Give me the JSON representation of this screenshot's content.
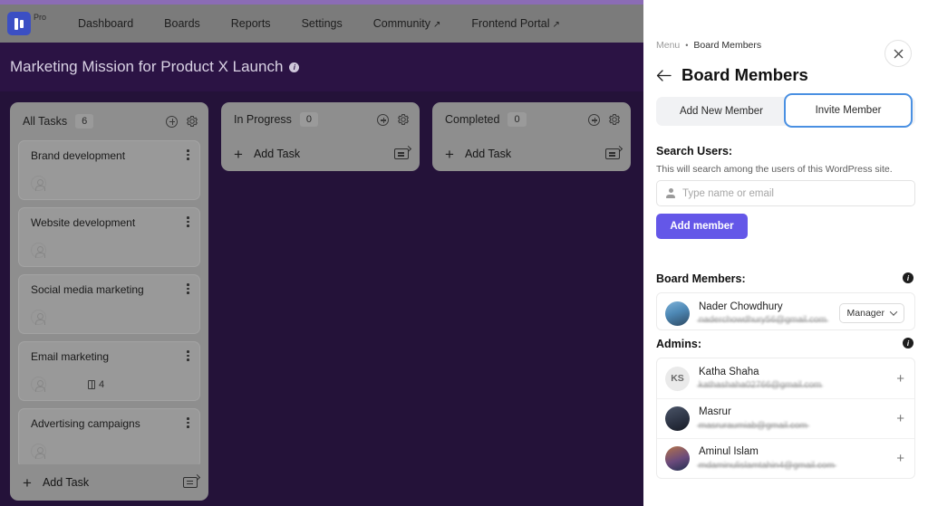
{
  "navbar": {
    "logo_name": "wedevs-pro-logo",
    "pro_badge": "Pro",
    "items": [
      {
        "label": "Dashboard",
        "external": ""
      },
      {
        "label": "Boards",
        "external": ""
      },
      {
        "label": "Reports",
        "external": ""
      },
      {
        "label": "Settings",
        "external": ""
      },
      {
        "label": "Community",
        "external": "↗"
      },
      {
        "label": "Frontend Portal",
        "external": "↗"
      }
    ]
  },
  "board": {
    "title": "Marketing Mission for Product X Launch",
    "info_glyph": "i",
    "add_task_label": "Add Task",
    "columns": [
      {
        "name": "All Tasks",
        "count": "6",
        "tasks": [
          {
            "title": "Brand development",
            "attachments": ""
          },
          {
            "title": "Website development",
            "attachments": ""
          },
          {
            "title": "Social media marketing",
            "attachments": ""
          },
          {
            "title": "Email marketing",
            "attachments": "4"
          },
          {
            "title": "Advertising campaigns",
            "attachments": ""
          }
        ]
      },
      {
        "name": "In Progress",
        "count": "0",
        "tasks": []
      },
      {
        "name": "Completed",
        "count": "0",
        "tasks": []
      }
    ]
  },
  "panel": {
    "breadcrumb": {
      "root": "Menu",
      "separator": "•",
      "current": "Board Members"
    },
    "title": "Board Members",
    "tabs": [
      {
        "label": "Add New Member",
        "selected": false
      },
      {
        "label": "Invite Member",
        "selected": true
      }
    ],
    "search": {
      "title": "Search Users:",
      "subtitle": "This will search among the users of this WordPress site.",
      "placeholder": "Type name or email",
      "value": "",
      "submit_label": "Add member"
    },
    "board_members": {
      "title": "Board Members:",
      "info_glyph": "i",
      "rows": [
        {
          "name": "Nader Chowdhury",
          "email": "naderchowdhury56@gmail.com",
          "initials": "",
          "role": "Manager",
          "action": ""
        }
      ]
    },
    "admins": {
      "title": "Admins:",
      "info_glyph": "i",
      "rows": [
        {
          "name": "Katha Shaha",
          "email": "kathashaha02766@gmail.com",
          "initials": "KS",
          "role": "",
          "action": "+"
        },
        {
          "name": "Masrur",
          "email": "masruraumiab@gmail.com",
          "initials": "",
          "role": "",
          "action": "+"
        },
        {
          "name": "Aminul Islam",
          "email": "mdaminulislamtahin4@gmail.com",
          "initials": "",
          "role": "",
          "action": "+"
        }
      ]
    },
    "close_label": "✕"
  },
  "annotation": {
    "type": "arrow",
    "color": "#4f90e0",
    "points_to": "Invite Member"
  },
  "colors": {
    "board_bg": "#241239",
    "navbar_bg": "#7b7b7b",
    "top_strip": "#8b6cb5",
    "accent_purple": "#6457e8",
    "highlight_blue": "#4a90e2"
  }
}
